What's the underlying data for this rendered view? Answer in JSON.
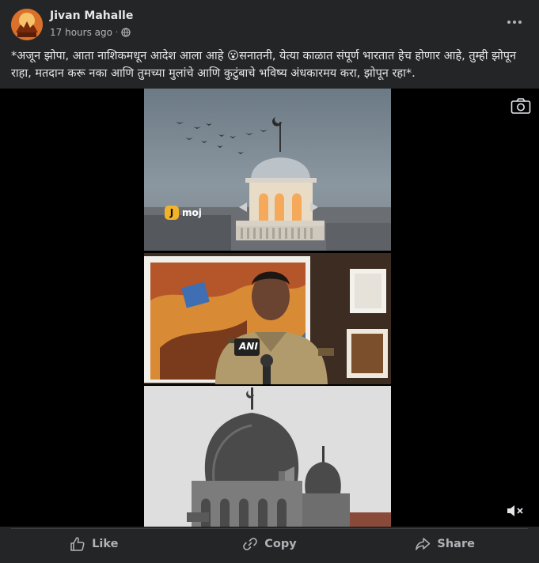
{
  "post": {
    "author": "Jivan Mahalle",
    "time": "17 hours ago",
    "separator": "·",
    "text": "*अजून झोपा, आता नाशिकमधून आदेश आला आहे 😮सनातनी, येत्या काळात संपूर्ण भारतात हेच होणार आहे, तुम्ही झोपून राहा, मतदान करू नका आणि तुमच्या मुलांचे आणि कुटुंबाचे भविष्य अंधकारमय करा, झोपून रहा*.",
    "privacy_icon": "globe-icon",
    "more_icon": "more-options-icon"
  },
  "video": {
    "watermark": "moj",
    "watermark_badge": "J",
    "mic_label": "ANI",
    "camera_icon": "camera-icon",
    "mute_icon": "speaker-muted-icon"
  },
  "actions": [
    {
      "label": "Like",
      "icon": "thumbs-up-icon"
    },
    {
      "label": "Copy",
      "icon": "link-icon"
    },
    {
      "label": "Share",
      "icon": "share-arrow-icon"
    }
  ],
  "colors": {
    "background": "#242526",
    "text_primary": "#e4e6eb",
    "text_secondary": "#b0b3b8",
    "divider": "#3e4042"
  }
}
